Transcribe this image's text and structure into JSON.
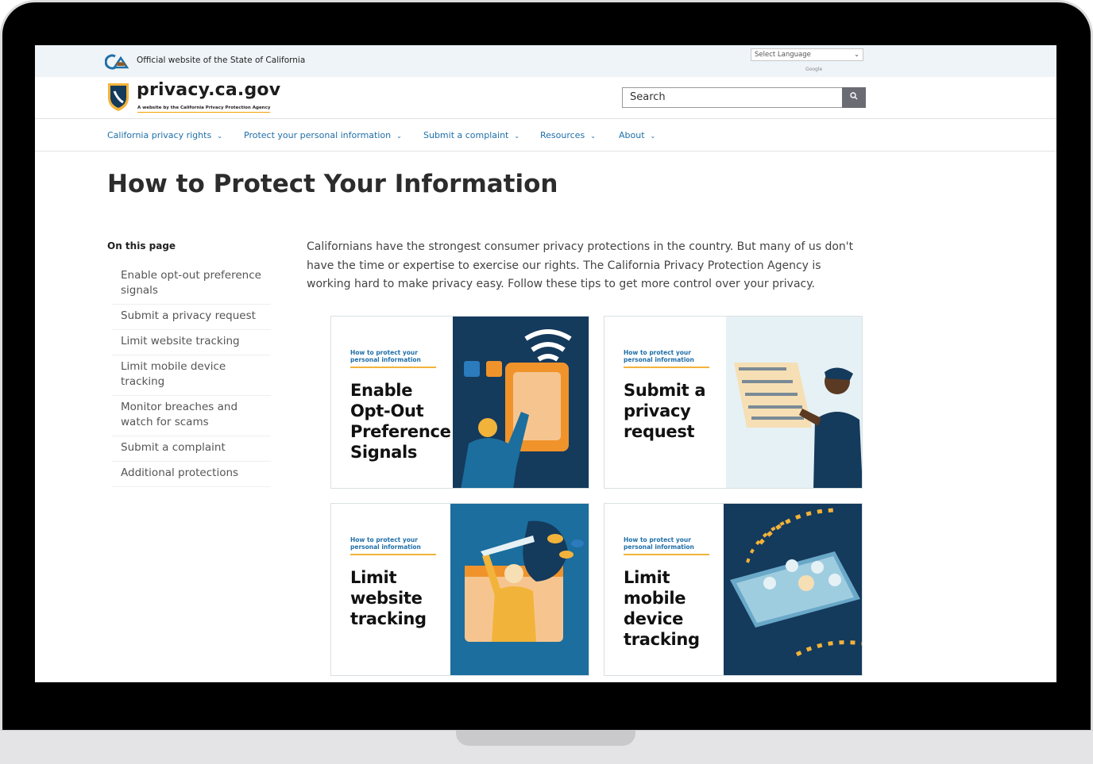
{
  "utility": {
    "official_text": "Official website of the State of California",
    "language_select": "Select Language",
    "google_mark": "Google"
  },
  "header": {
    "site_name": "privacy.ca.gov",
    "tagline": "A website by the California Privacy Protection Agency",
    "search_placeholder": "Search"
  },
  "nav": {
    "items": [
      {
        "label": "California privacy rights"
      },
      {
        "label": "Protect your personal information"
      },
      {
        "label": "Submit a complaint"
      },
      {
        "label": "Resources"
      },
      {
        "label": "About"
      }
    ]
  },
  "page": {
    "title": "How to Protect Your Information"
  },
  "on_this_page": {
    "heading": "On this page",
    "items": [
      "Enable opt-out preference signals",
      "Submit a privacy request",
      "Limit website tracking",
      "Limit mobile device tracking",
      "Monitor breaches and watch for scams",
      "Submit a complaint",
      "Additional protections"
    ]
  },
  "intro": {
    "text": "Californians have the strongest consumer privacy protections in the country. But many of us don't have the time or expertise to exercise our rights. The California Privacy Protection Agency is working hard to make privacy easy. Follow these tips to get more control over your privacy."
  },
  "cards": [
    {
      "eyebrow": "How to protect your personal information",
      "title": "Enable Opt-Out Preference Signals"
    },
    {
      "eyebrow": "How to protect your personal information",
      "title": "Submit a privacy request"
    },
    {
      "eyebrow": "How to protect your personal information",
      "title": "Limit website tracking"
    },
    {
      "eyebrow": "How to protect your personal information",
      "title": "Limit mobile device tracking"
    }
  ],
  "colors": {
    "link_blue": "#1f6fa8",
    "accent_gold": "#f2b33a",
    "navy": "#143a5c",
    "teal_blue": "#1b6e9e"
  }
}
